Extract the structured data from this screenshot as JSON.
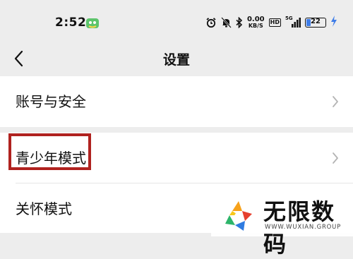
{
  "status_bar": {
    "time": "2:52",
    "net_speed_value": "0.00",
    "net_speed_unit": "KB/S",
    "hd_badge": "HD",
    "signal_label": "5G",
    "battery_level": "22",
    "battery_color": "#3f7de8",
    "icons": [
      "app-badge-icon",
      "alarm-icon",
      "mute-bell-icon",
      "bluetooth-icon",
      "signal-icon",
      "battery-icon",
      "charging-bolt-icon"
    ]
  },
  "nav": {
    "back_icon": "chevron-left-icon",
    "title": "设置"
  },
  "settings": {
    "items": [
      {
        "label": "账号与安全"
      },
      {
        "label": "青少年模式"
      },
      {
        "label": "关怀模式"
      }
    ]
  },
  "highlight": {
    "color": "#b0221f"
  },
  "watermark": {
    "title": "无限数码",
    "subtitle": "WWW.WUXIAN.GROUP"
  }
}
